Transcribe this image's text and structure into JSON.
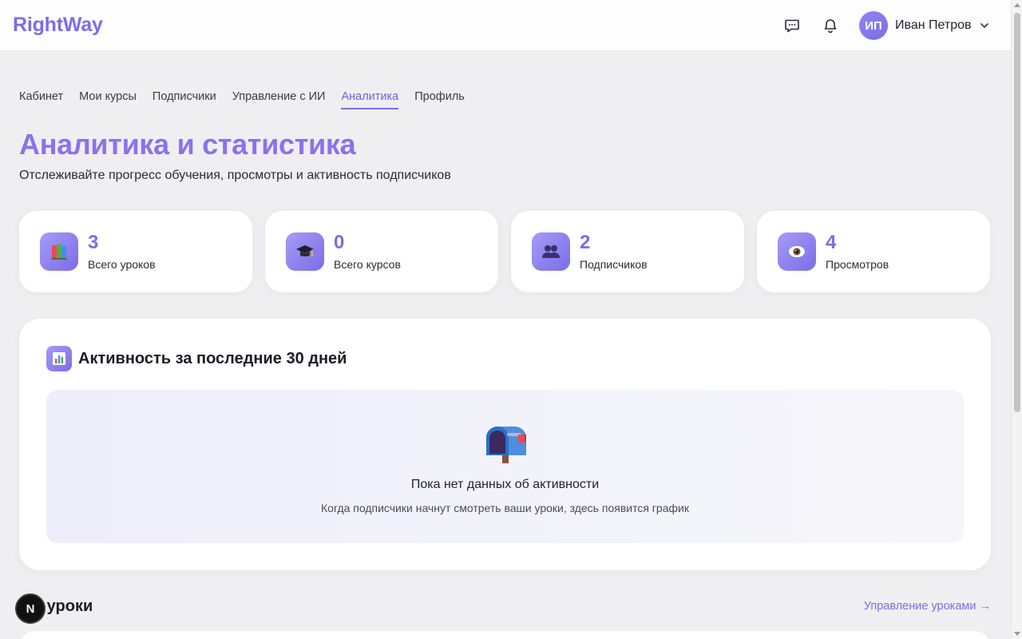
{
  "header": {
    "logo": "RightWay",
    "user": {
      "initials": "ИП",
      "name": "Иван Петров"
    }
  },
  "nav": {
    "items": [
      "Кабинет",
      "Мои курсы",
      "Подписчики",
      "Управление с ИИ",
      "Аналитика",
      "Профиль"
    ],
    "active": "Аналитика"
  },
  "page": {
    "title": "Аналитика и статистика",
    "subtitle": "Отслеживайте прогресс обучения, просмотры и активность подписчиков"
  },
  "stats": [
    {
      "icon": "books-icon",
      "value": "3",
      "label": "Всего уроков"
    },
    {
      "icon": "graduation-cap-icon",
      "value": "0",
      "label": "Всего курсов"
    },
    {
      "icon": "people-icon",
      "value": "2",
      "label": "Подписчиков"
    },
    {
      "icon": "eye-icon",
      "value": "4",
      "label": "Просмотров"
    }
  ],
  "activity": {
    "icon": "bar-chart-icon",
    "title": "Активность за последние 30 дней",
    "empty_icon": "mailbox-icon",
    "empty_title": "Пока нет данных об активности",
    "empty_desc": "Когда подписчики начнут смотреть ваши уроки, здесь появится график"
  },
  "lessons": {
    "title": "е уроки",
    "link": "Управление уроками →"
  },
  "badge": {
    "letter": "N"
  },
  "colors": {
    "accent": "#7c6ce8",
    "background": "#efeff2"
  }
}
